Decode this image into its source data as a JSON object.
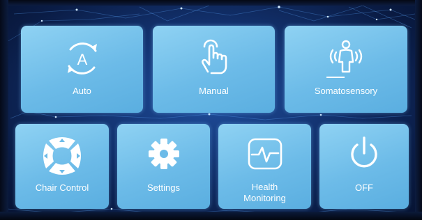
{
  "tiles": {
    "auto": {
      "label": "Auto",
      "icon": "auto-mode-icon"
    },
    "manual": {
      "label": "Manual",
      "icon": "hand-touch-icon"
    },
    "somatosensory": {
      "label": "Somatosensory",
      "icon": "person-sensing-icon"
    },
    "chair_control": {
      "label": "Chair Control",
      "icon": "direction-pad-icon"
    },
    "settings": {
      "label": "Settings",
      "icon": "gear-icon"
    },
    "health": {
      "label_line1": "Health",
      "label_line2": "Monitoring",
      "icon": "heart-rate-monitor-icon"
    },
    "off": {
      "label": "OFF",
      "icon": "power-icon"
    }
  },
  "colors": {
    "tile": "#6cbbe8",
    "background": "#12306b",
    "text": "#ffffff"
  }
}
